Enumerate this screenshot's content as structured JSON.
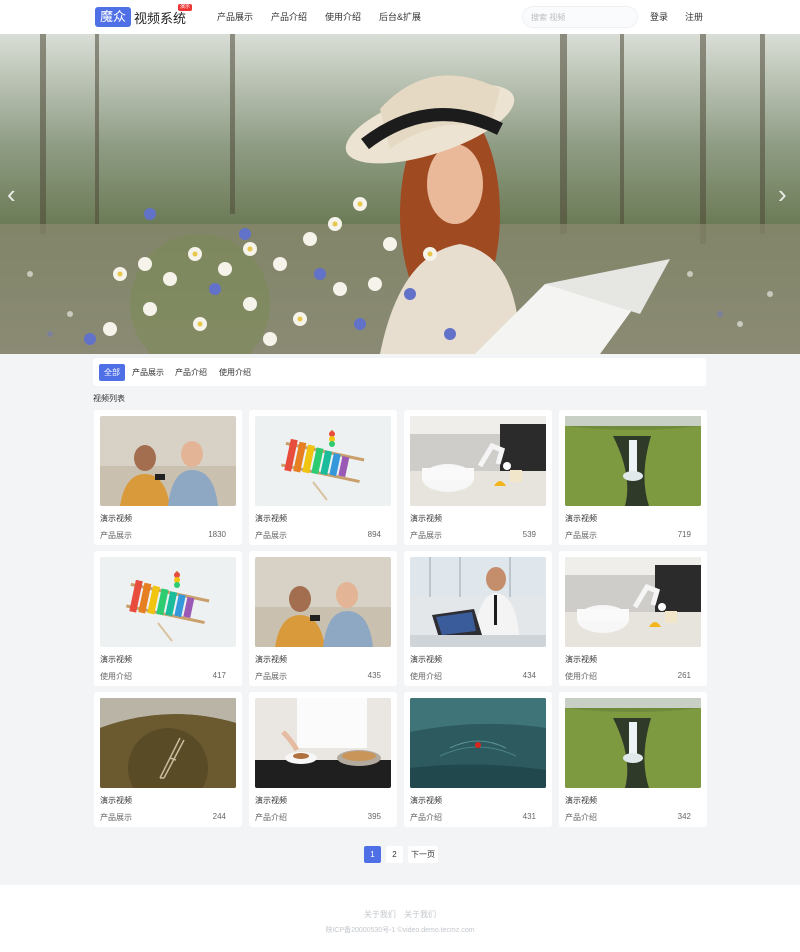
{
  "header": {
    "logo_box": "魔众",
    "logo_text": "视频系统",
    "logo_badge": "演示",
    "nav": [
      "产品展示",
      "产品介绍",
      "使用介绍",
      "后台&扩展"
    ],
    "search_placeholder": "搜索 视频",
    "login": "登录",
    "register": "注册"
  },
  "banner": {
    "prev_icon": "chevron-left-icon",
    "next_icon": "chevron-right-icon"
  },
  "filters": [
    "全部",
    "产品展示",
    "产品介绍",
    "使用介绍"
  ],
  "section_title": "视频列表",
  "videos": [
    {
      "title": "演示视频",
      "category": "产品展示",
      "views": "1830",
      "thumb": "friends-sofa"
    },
    {
      "title": "演示视频",
      "category": "产品展示",
      "views": "894",
      "thumb": "xylophone"
    },
    {
      "title": "演示视频",
      "category": "产品展示",
      "views": "539",
      "thumb": "kitchen-robot"
    },
    {
      "title": "演示视频",
      "category": "产品展示",
      "views": "719",
      "thumb": "waterfall"
    },
    {
      "title": "演示视频",
      "category": "使用介绍",
      "views": "417",
      "thumb": "xylophone"
    },
    {
      "title": "演示视频",
      "category": "产品展示",
      "views": "435",
      "thumb": "friends-sofa"
    },
    {
      "title": "演示视频",
      "category": "使用介绍",
      "views": "434",
      "thumb": "businessman-laptop"
    },
    {
      "title": "演示视频",
      "category": "使用介绍",
      "views": "261",
      "thumb": "kitchen-robot"
    },
    {
      "title": "演示视频",
      "category": "产品展示",
      "views": "244",
      "thumb": "aerial-tower"
    },
    {
      "title": "演示视频",
      "category": "产品介绍",
      "views": "395",
      "thumb": "chef-cooking"
    },
    {
      "title": "演示视频",
      "category": "产品介绍",
      "views": "431",
      "thumb": "sea-swimmer"
    },
    {
      "title": "演示视频",
      "category": "产品介绍",
      "views": "342",
      "thumb": "waterfall"
    }
  ],
  "pagination": {
    "pages": [
      "1",
      "2"
    ],
    "next": "下一页",
    "current": "1"
  },
  "footer": {
    "links": [
      "关于我们",
      "关于我们"
    ],
    "copyright": "陕ICP备20000530号-1 ©video.demo.tecmz.com"
  },
  "colors": {
    "accent": "#4f6fe6",
    "background": "#f3f4f6"
  }
}
